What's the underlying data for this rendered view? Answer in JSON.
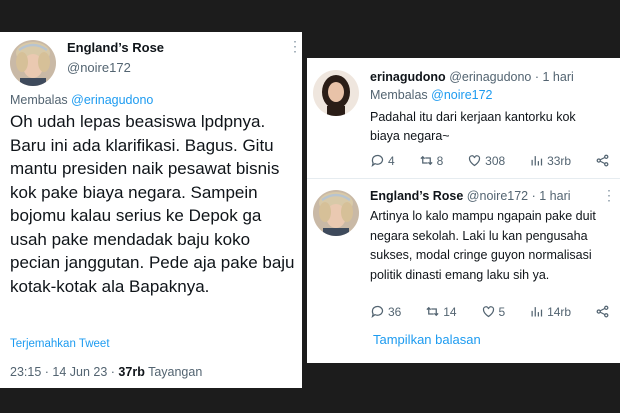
{
  "main_tweet": {
    "name": "England’s Rose",
    "handle": "@noire172",
    "reply_prefix": "Membalas",
    "reply_to": "@erinagudono",
    "text": "Oh udah lepas beasiswa lpdpnya. Baru ini ada klarifikasi. Bagus. Gitu mantu presiden naik pesawat bisnis kok pake biaya negara. Sampein bojomu kalau serius ke Depok ga usah pake mendadak baju koko pecian janggutan. Pede aja pake baju kotak-kotak ala Bapaknya.",
    "translate": "Terjemahkan Tweet",
    "time": "23:15 · 14 Jun 23 ·",
    "views_count": "37rb",
    "views_label": "Tayangan"
  },
  "reply1": {
    "name": "erinagudono",
    "handle": "@erinagudono · 1 hari",
    "reply_prefix": "Membalas",
    "reply_to": "@noire172",
    "text": "Padahal itu dari kerjaan kantorku kok biaya negara~",
    "replies": "4",
    "retweets": "8",
    "likes": "308",
    "views": "33rb"
  },
  "reply2": {
    "name": "England’s Rose",
    "handle": "@noire172 · 1 hari",
    "text": "Artinya lo kalo mampu ngapain pake duit negara sekolah. Laki lu kan pengusaha sukses, modal cringe guyon normalisasi politik dinasti emang laku sih ya.",
    "replies": "36",
    "retweets": "14",
    "likes": "5",
    "views": "14rb"
  },
  "show_replies": "Tampilkan balasan",
  "colors": {
    "link": "#1d9bf0",
    "muted": "#536471",
    "text": "#0f1419"
  }
}
